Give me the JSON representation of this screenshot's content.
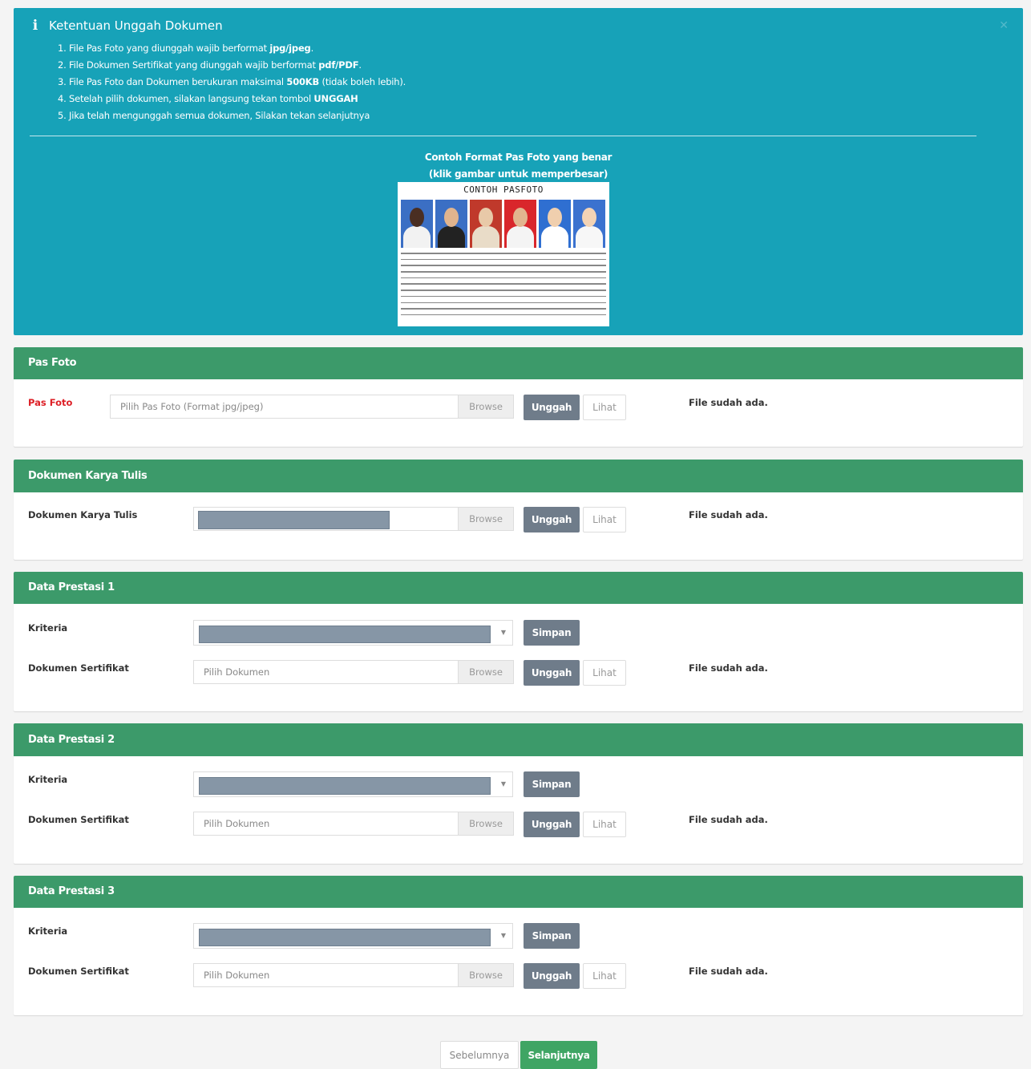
{
  "alert": {
    "title": "Ketentuan Unggah Dokumen",
    "items": [
      [
        "1. File Pas Foto yang diunggah wajib berformat ",
        "jpg/jpeg",
        "."
      ],
      [
        "2. File Dokumen Sertifikat yang diunggah wajib berformat ",
        "pdf/PDF",
        "."
      ],
      [
        "3. File Pas Foto dan Dokumen berukuran maksimal ",
        "500KB",
        " (tidak boleh lebih)."
      ],
      [
        "4. Setelah pilih dokumen, silakan langsung tekan tombol ",
        "UNGGAH",
        ""
      ],
      [
        "5. Jika telah mengunggah semua dokumen, Silakan tekan selanjutnya",
        "",
        ""
      ]
    ],
    "example_line1": "Contoh Format Pas Foto yang benar",
    "example_line2": "(klik gambar untuk memperbesar)",
    "sample_title": "CONTOH PASFOTO",
    "sample_photos": [
      {
        "bg": "#3b6fc4",
        "skin": "#4a2e22",
        "shirt": "#f2f2f2"
      },
      {
        "bg": "#3b6fc4",
        "skin": "#e0b48e",
        "shirt": "#222222"
      },
      {
        "bg": "#c0392b",
        "skin": "#e8c9a8",
        "shirt": "#e9dcc8"
      },
      {
        "bg": "#d9262b",
        "skin": "#e2b58f",
        "shirt": "#f4f4f4"
      },
      {
        "bg": "#2f6fd1",
        "skin": "#f0cfae",
        "shirt": "#ffffff"
      },
      {
        "bg": "#3b72cf",
        "skin": "#f2d3b5",
        "shirt": "#f7f7f7"
      }
    ]
  },
  "common": {
    "browse": "Browse",
    "upload": "Unggah",
    "view": "Lihat",
    "save": "Simpan",
    "status": "File sudah ada."
  },
  "pas_foto": {
    "header": "Pas Foto",
    "label": "Pas Foto",
    "placeholder": "Pilih Pas Foto (Format jpg/jpeg)"
  },
  "karya_tulis": {
    "header": "Dokumen Karya Tulis",
    "label": "Dokumen Karya Tulis"
  },
  "prestasi": [
    {
      "header": "Data Prestasi 1",
      "kriteria_label": "Kriteria",
      "doc_label": "Dokumen Sertifikat",
      "placeholder": "Pilih Dokumen"
    },
    {
      "header": "Data Prestasi 2",
      "kriteria_label": "Kriteria",
      "doc_label": "Dokumen Sertifikat",
      "placeholder": "Pilih Dokumen"
    },
    {
      "header": "Data Prestasi 3",
      "kriteria_label": "Kriteria",
      "doc_label": "Dokumen Sertifikat",
      "placeholder": "Pilih Dokumen"
    }
  ],
  "footer": {
    "prev": "Sebelumnya",
    "next": "Selanjutnya"
  }
}
